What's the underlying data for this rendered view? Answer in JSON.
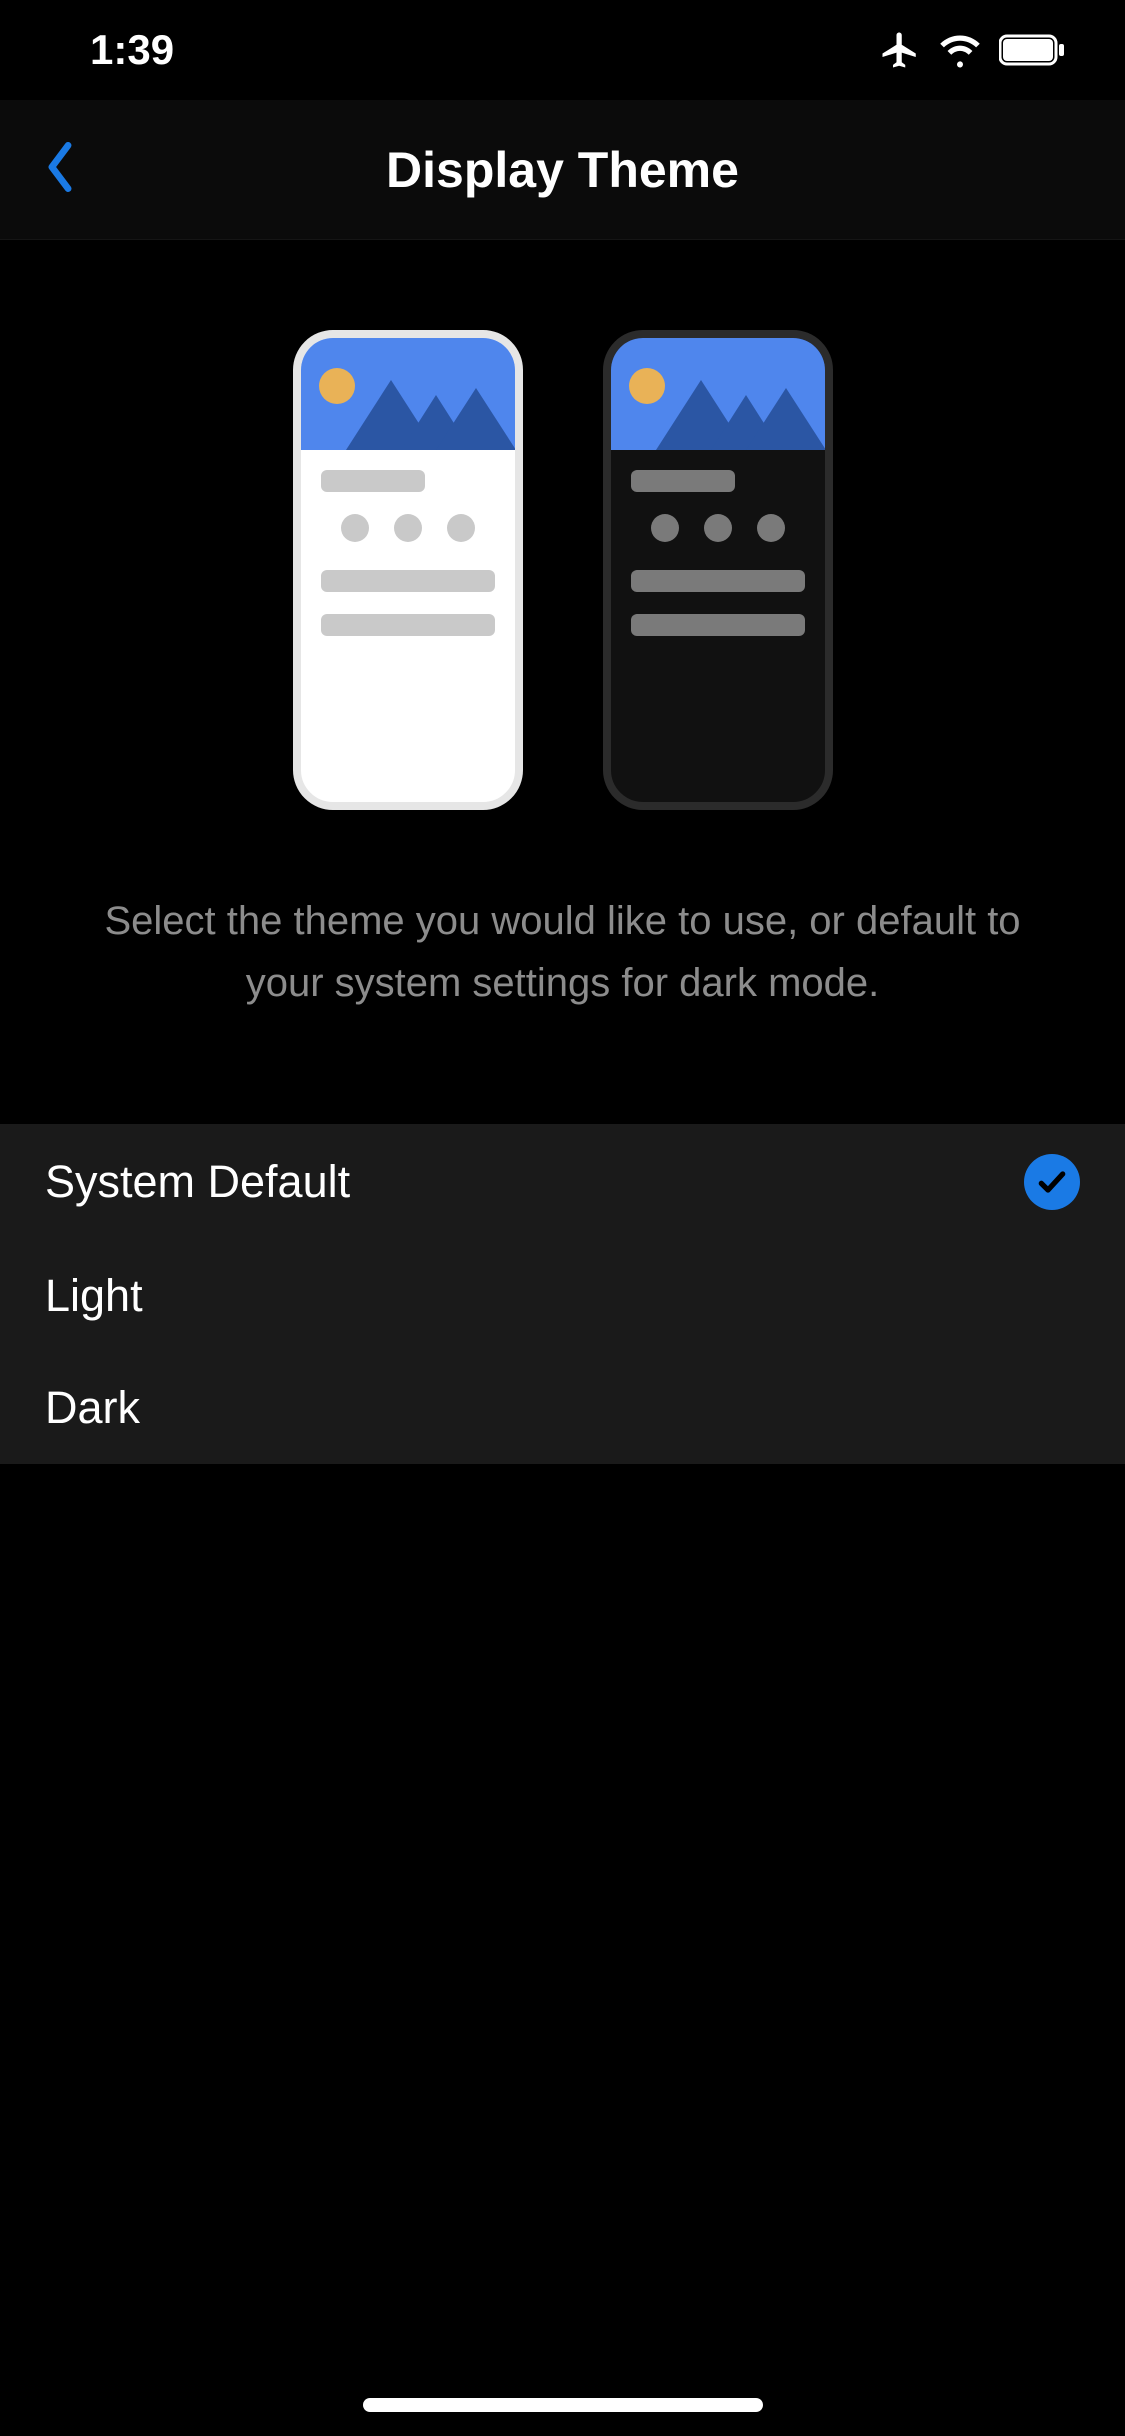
{
  "statusBar": {
    "time": "1:39"
  },
  "nav": {
    "title": "Display Theme"
  },
  "description": "Select the theme you would like to use, or default to your system settings for dark mode.",
  "options": [
    {
      "label": "System Default",
      "selected": true
    },
    {
      "label": "Light",
      "selected": false
    },
    {
      "label": "Dark",
      "selected": false
    }
  ],
  "icons": {
    "back": "chevron-left",
    "airplane": "airplane-mode",
    "wifi": "wifi",
    "battery": "battery"
  },
  "colors": {
    "accent": "#1a7ae5",
    "descriptionText": "#8c8c8c",
    "listBackground": "#1a1a1a"
  }
}
